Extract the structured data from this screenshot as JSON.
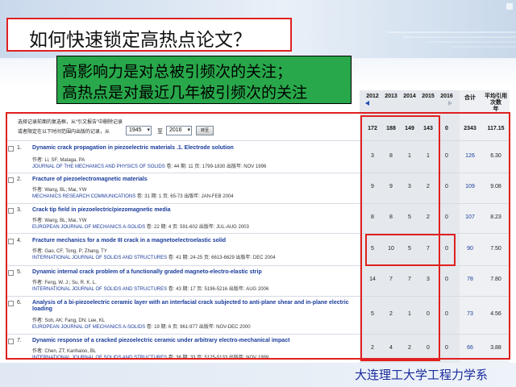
{
  "slide": {
    "title": "如何快速锁定高热点论文？",
    "note_lines": [
      "高影响力是对总被引频次的关注；",
      "高热点是对最近几年被引频次的关注"
    ],
    "footer": "大连理工大学工程力学系"
  },
  "citation_panel": {
    "years": [
      "2012",
      "2013",
      "2014",
      "2015",
      "2016"
    ],
    "total_label": "合计",
    "avg_label": [
      "平均引用",
      "次数",
      "年"
    ],
    "controls": {
      "line1": "选择记录前面的复选框，从“引文报告”中删除记录",
      "line2": "或者限定在以下时间范围内出版的记录，从",
      "from_year": "1945",
      "to_label": "至",
      "to_year": "2016",
      "go_button": "转至"
    },
    "year_sums": [
      "172",
      "188",
      "149",
      "143",
      "0"
    ],
    "grand_total": "2343",
    "grand_avg": "117.15"
  },
  "records": [
    {
      "num": "1.",
      "title": "Dynamic crack propagation in piezoelectric materials .1. Electrode solution",
      "authors": "作者: Li, SF; Mataga, PA",
      "journal": "JOURNAL OF THE MECHANICS AND PHYSICS OF SOLIDS",
      "details": " 卷: 44  期: 11  页: 1799-1830  出版年: NOV 1996",
      "cites": [
        "3",
        "8",
        "1",
        "1",
        "0"
      ],
      "total": "126",
      "avg": "6.30"
    },
    {
      "num": "2.",
      "title": "Fracture of piezoelectromagnetic materials",
      "authors": "作者: Wang, BL; Mai, YW",
      "journal": "MECHANICS RESEARCH COMMUNICATIONS",
      "details": " 卷: 31  期: 1  页: 65-73  出版年: JAN-FEB 2004",
      "cites": [
        "9",
        "9",
        "3",
        "2",
        "0"
      ],
      "total": "109",
      "avg": "9.08"
    },
    {
      "num": "3.",
      "title": "Crack tip field in piezoelectric/piezomagnetic media",
      "authors": "作者: Wang, BL; Mai, YW",
      "journal": "EUROPEAN JOURNAL OF MECHANICS A-SOLIDS",
      "details": " 卷: 22  期: 4  页: 591-602  出版年: JUL-AUG 2003",
      "cites": [
        "8",
        "8",
        "5",
        "2",
        "0"
      ],
      "total": "107",
      "avg": "8.23"
    },
    {
      "num": "4.",
      "title": "Fracture mechanics for a mode III crack in a magnetoelectroelastic solid",
      "authors": "作者: Gao, CF; Tong, P; Zhang, TY",
      "journal": "INTERNATIONAL JOURNAL OF SOLIDS AND STRUCTURES",
      "details": " 卷: 41  期: 24-25  页: 6613-6629  出版年: DEC 2004",
      "cites": [
        "5",
        "10",
        "5",
        "7",
        "0"
      ],
      "total": "90",
      "avg": "7.50"
    },
    {
      "num": "5.",
      "title": "Dynamic internal crack problem of a functionally graded magneto-electro-elastic strip",
      "authors": "作者: Feng, W. J.; Su, R. K. L.",
      "journal": "INTERNATIONAL JOURNAL OF SOLIDS AND STRUCTURES",
      "details": " 卷: 43  期: 17  页: 5196-5216  出版年: AUG 2006",
      "cites": [
        "14",
        "7",
        "7",
        "3",
        "0"
      ],
      "total": "78",
      "avg": "7.80"
    },
    {
      "num": "6.",
      "title": "Analysis of a bi-piezoelectric ceramic layer with an interfacial crack subjected to anti-plane shear and in-plane electric loading",
      "authors": "作者: Soh, AK; Fang, DN; Lee, KL",
      "journal": "EUROPEAN JOURNAL OF MECHANICS A-SOLIDS",
      "details": " 卷: 19  期: 6  页: 961-977  出版年: NOV-DEC 2000",
      "cites": [
        "5",
        "2",
        "1",
        "0",
        "0"
      ],
      "total": "73",
      "avg": "4.56"
    },
    {
      "num": "7.",
      "title": "Dynamic response of a cracked piezoelectric ceramic under arbitrary electro-mechanical impact",
      "authors": "作者: Chen, ZT; Karihaloo, BL",
      "journal": "INTERNATIONAL JOURNAL OF SOLIDS AND STRUCTURES",
      "details": " 卷: 36  期: 33  页: 5125-5133  出版年: NOV 1999",
      "cites": [
        "2",
        "4",
        "2",
        "0",
        "0"
      ],
      "total": "66",
      "avg": "3.88"
    }
  ]
}
